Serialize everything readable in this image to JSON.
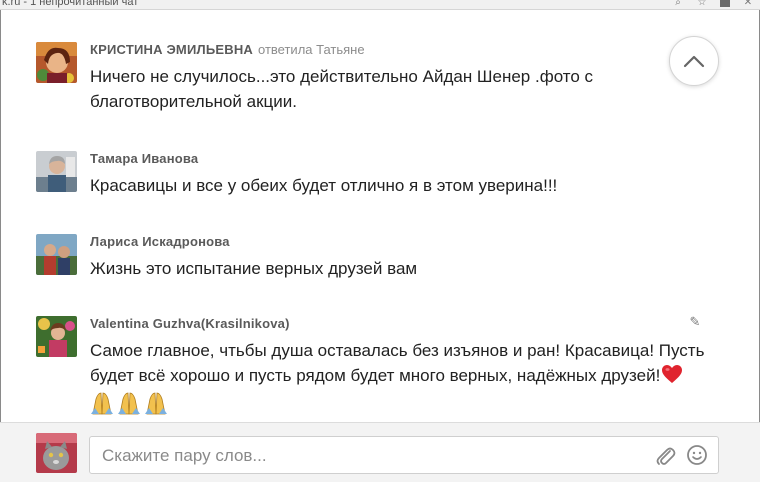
{
  "window": {
    "title": "k.ru - 1 непрочитанный чат"
  },
  "comments": [
    {
      "author": "КРИСТИНА ЭМИЛЬЕВНА",
      "reply_to": "ответила Татьяне",
      "text": "Ничего не случилось...это действительно Айдан Шенер .фото с благотворительной акции."
    },
    {
      "author": "Тамара Иванова",
      "text": "Красавицы и все у обеих будет отлично я в этом уверина!!!"
    },
    {
      "author": "Лариса Искадронова",
      "text": "Жизнь это испытание  верных друзей вам"
    },
    {
      "author": "Valentina Guzhva(Krasilnikova)",
      "text": "Самое главное, чтьбы душа оставалась без изъянов и ран! Красавица! Пусть будет всё хорошо и пусть рядом будет много верных, надёжных друзей!",
      "emoji_end": "red-heart",
      "emoji_row": [
        "folded-hands",
        "folded-hands",
        "folded-hands"
      ]
    }
  ],
  "composer": {
    "placeholder": "Скажите пару слов..."
  },
  "icons": {
    "scroll_up": "chevron-up-icon",
    "edit": "pencil-icon",
    "attach": "paperclip-icon",
    "emoji": "smiley-icon"
  },
  "colors": {
    "author": "#5a5a5a",
    "reply_to": "#8c8c8c",
    "text": "#222222",
    "heart": "#e0242e",
    "composer_bg": "#f3f3f3"
  }
}
